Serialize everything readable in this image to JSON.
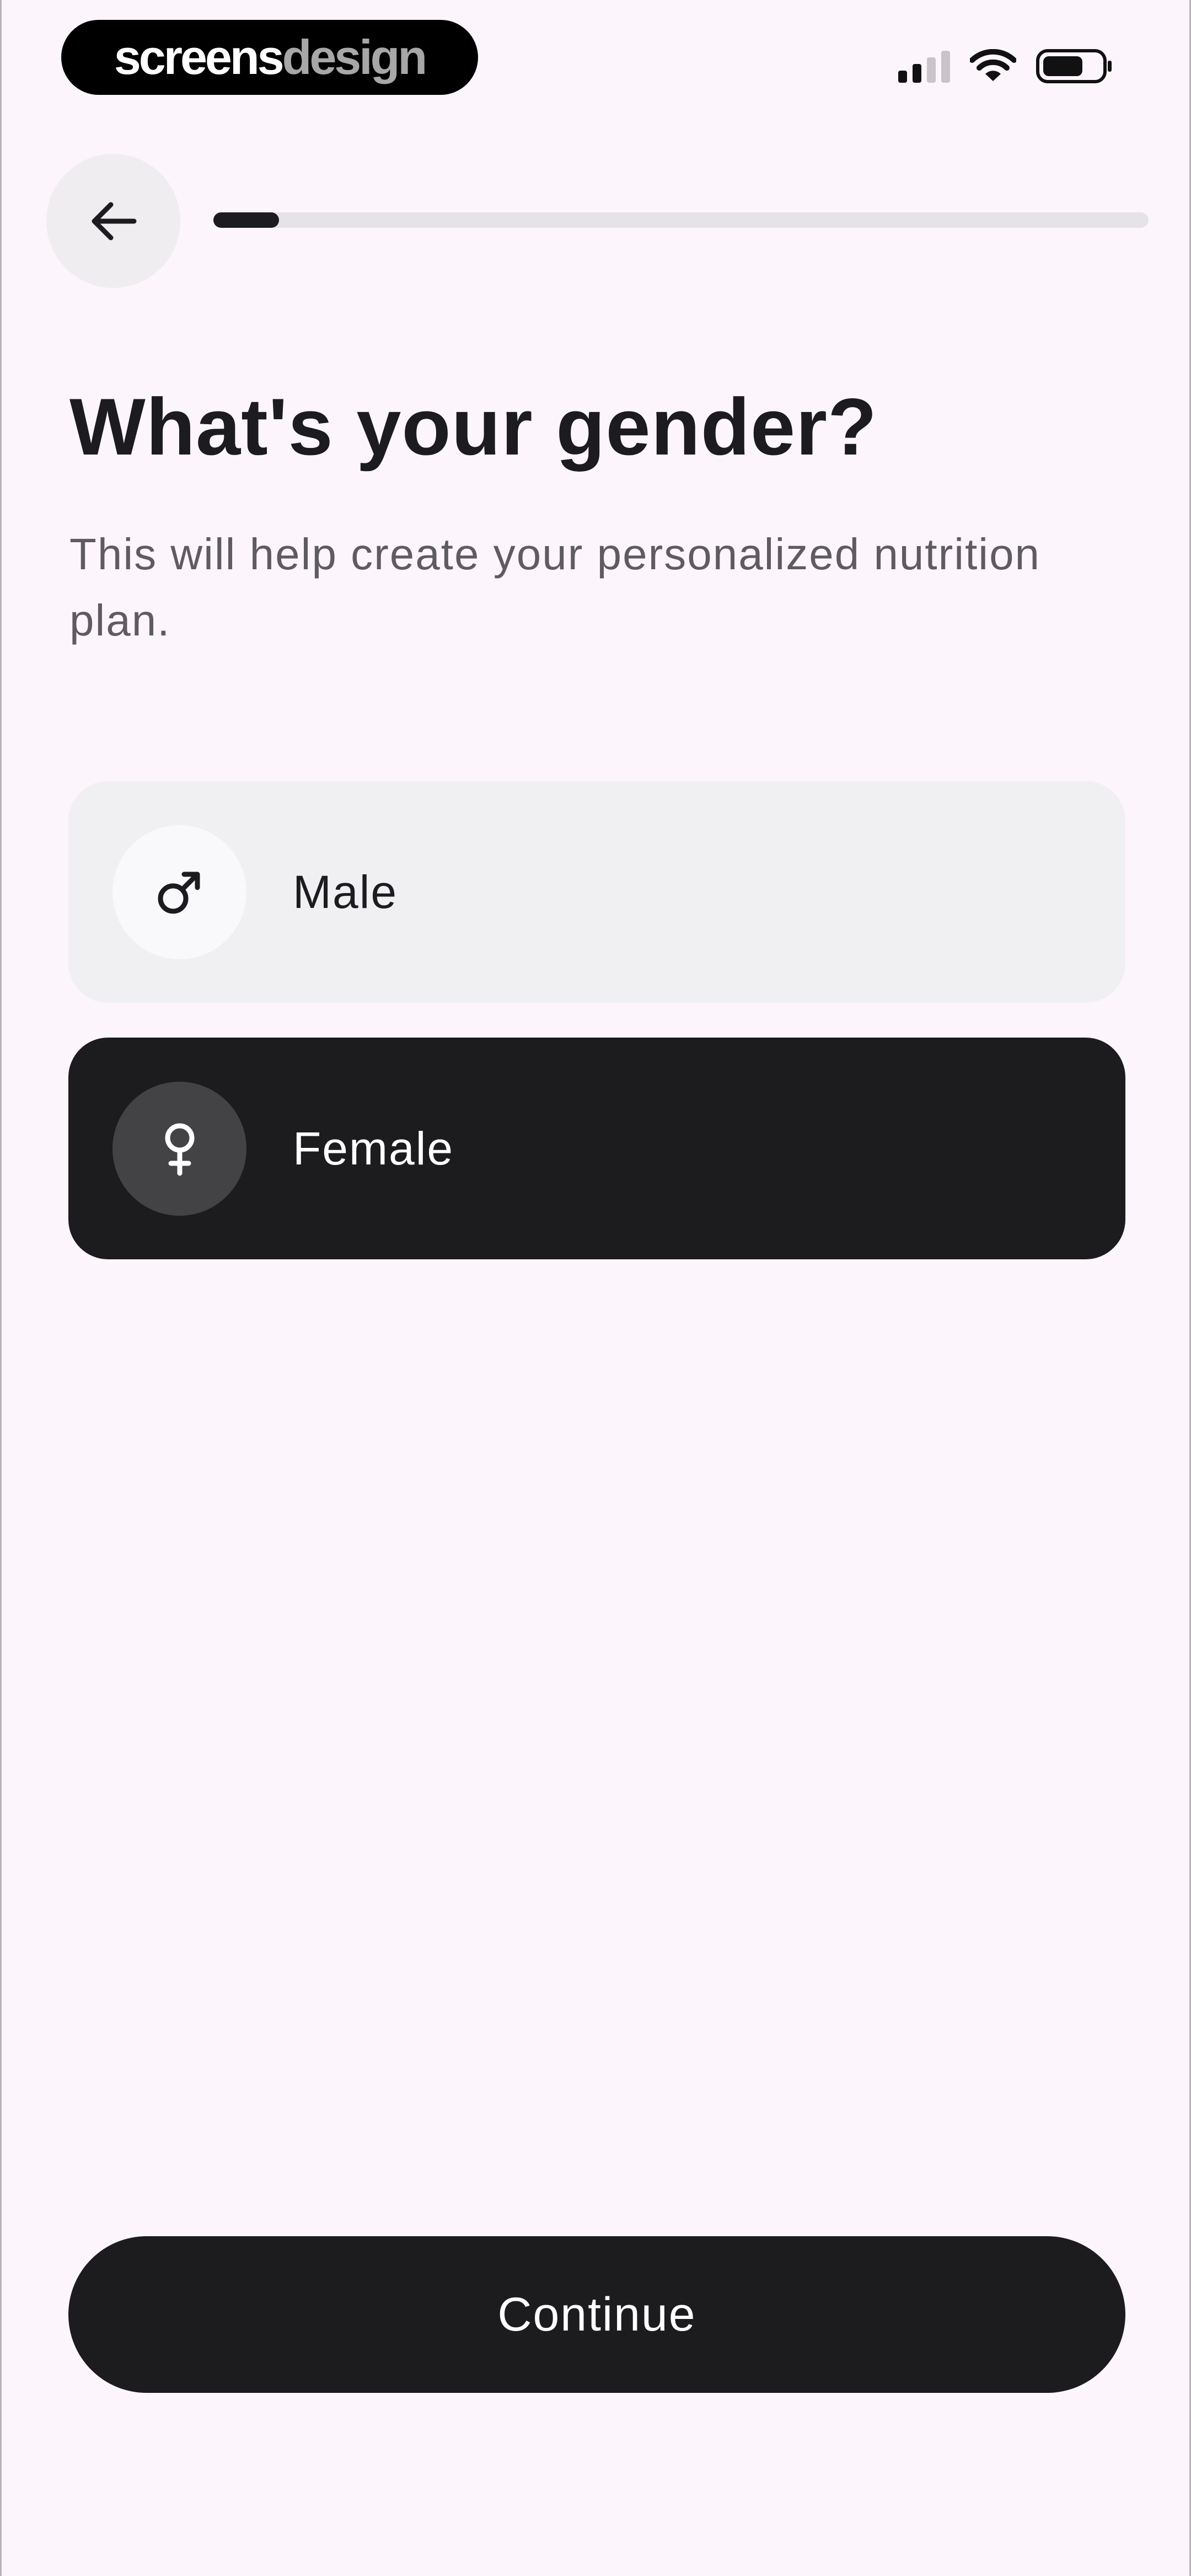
{
  "status_bar": {
    "brand_part1": "screens",
    "brand_part2": "design",
    "signal_bars_on": 2,
    "signal_bars_total": 4,
    "battery_level": 0.7
  },
  "nav": {
    "back_icon": "arrow-left-icon",
    "progress": 0.07
  },
  "header": {
    "title": "What's your gender?",
    "subtitle": "This will help create your personalized nutrition plan."
  },
  "options": [
    {
      "label": "Male",
      "icon": "male-symbol-icon",
      "selected": false
    },
    {
      "label": "Female",
      "icon": "female-symbol-icon",
      "selected": true
    }
  ],
  "footer": {
    "continue_label": "Continue"
  },
  "colors": {
    "background": "#fdf5fc",
    "primary": "#1c1b1e",
    "unselected_option": "#f0eff2",
    "subtitle": "#5e5b61"
  }
}
